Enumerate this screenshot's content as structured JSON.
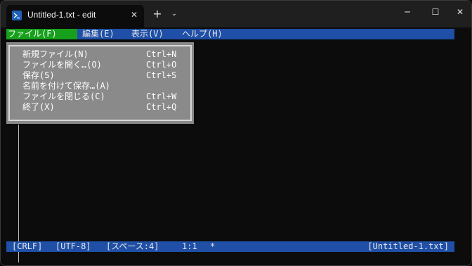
{
  "window": {
    "tab_title": "Untitled-1.txt - edit",
    "tab_close": "✕",
    "new_tab": "+",
    "tab_dropdown": "⌄",
    "minimize": "─",
    "maximize": "☐",
    "close": "✕"
  },
  "menubar": {
    "file": "ファイル(F)",
    "edit": "編集(E)",
    "view": "表示(V)",
    "help": "ヘルプ(H)"
  },
  "file_menu": {
    "items": [
      {
        "label": "新規ファイル(N)",
        "shortcut": "Ctrl+N"
      },
      {
        "label": "ファイルを開く…(O)",
        "shortcut": "Ctrl+O"
      },
      {
        "label": "保存(S)",
        "shortcut": "Ctrl+S"
      },
      {
        "label": "名前を付けて保存…(A)",
        "shortcut": ""
      },
      {
        "label": "ファイルを閉じる(C)",
        "shortcut": "Ctrl+W"
      },
      {
        "label": "終了(X)",
        "shortcut": "Ctrl+Q"
      }
    ]
  },
  "statusbar": {
    "line_ending": "[CRLF]",
    "encoding": "[UTF-8]",
    "indent": "[スペース:4]",
    "position": "1:1",
    "modified": "*",
    "filename": "[Untitled-1.txt]"
  },
  "colors": {
    "menubar_bg": "#1f4fa6",
    "menu_active_bg": "#16a01c",
    "dropdown_bg": "#8a8a8a",
    "terminal_bg": "#0c0c0c"
  },
  "icons": {
    "tab_icon": "powershell-icon"
  }
}
